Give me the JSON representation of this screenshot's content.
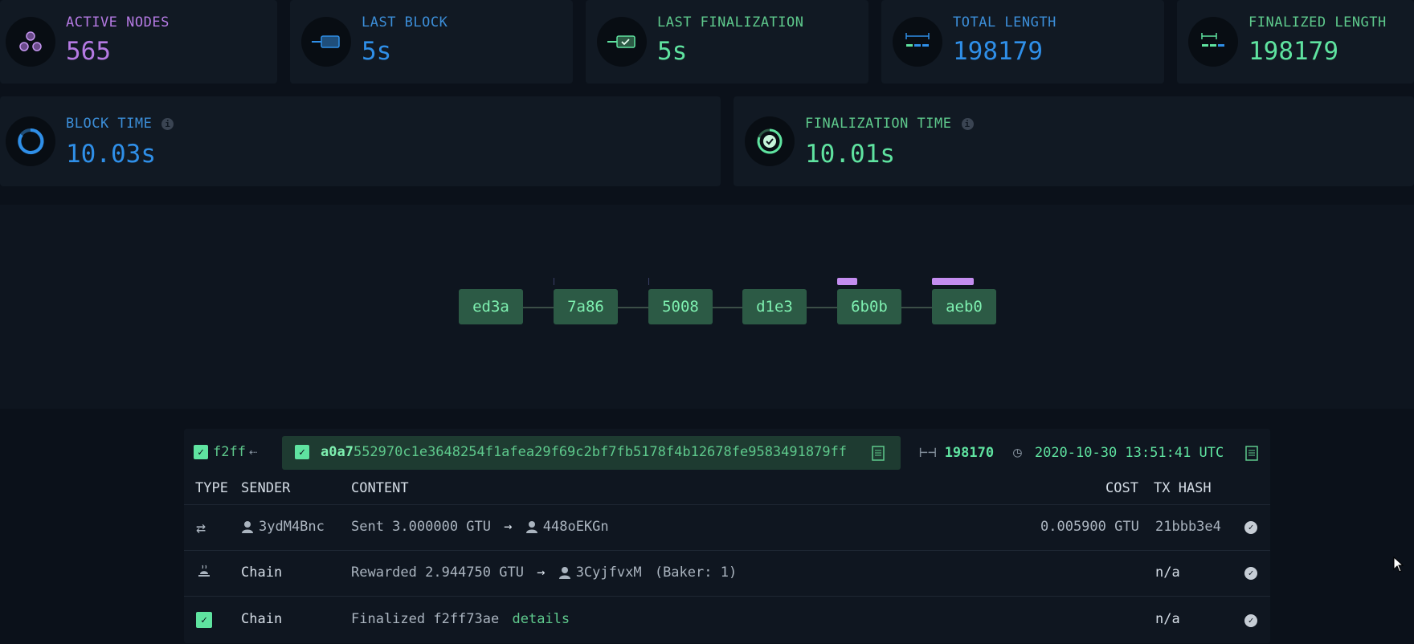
{
  "stats_top": [
    {
      "label": "ACTIVE NODES",
      "value": "565",
      "icon": "nodes-icon"
    },
    {
      "label": "LAST BLOCK",
      "value": "5s",
      "icon": "block-icon"
    },
    {
      "label": "LAST FINALIZATION",
      "value": "5s",
      "icon": "finalized-block-icon"
    },
    {
      "label": "TOTAL LENGTH",
      "value": "198179",
      "icon": "chain-length-icon"
    },
    {
      "label": "FINALIZED LENGTH",
      "value": "198179",
      "icon": "finalized-length-icon"
    }
  ],
  "stats_bottom": [
    {
      "label": "BLOCK TIME",
      "value": "10.03s",
      "icon": "block-time-icon"
    },
    {
      "label": "FINALIZATION TIME",
      "value": "10.01s",
      "icon": "finalization-time-icon"
    }
  ],
  "chain": {
    "blocks": [
      "ed3a",
      "7a86",
      "5008",
      "d1e3",
      "6b0b",
      "aeb0"
    ]
  },
  "block_detail": {
    "parent_short": "f2ff",
    "hash_bold": "a0a7",
    "hash_rest": "552970c1e3648254f1afea29f69c2bf7fb5178f4b12678fe9583491879ff",
    "height": "198170",
    "timestamp": "2020-10-30 13:51:41 UTC"
  },
  "table": {
    "headers": {
      "type": "TYPE",
      "sender": "SENDER",
      "content": "CONTENT",
      "cost": "COST",
      "tx_hash": "TX HASH"
    },
    "rows": [
      {
        "type_icon": "transfer-icon",
        "sender": "3ydM4Bnc",
        "content_prefix": "Sent 3.000000 GTU",
        "arrow": "→",
        "recipient": "448oEKGn",
        "content_suffix": "",
        "cost": "0.005900 GTU",
        "tx_hash": "21bbb3e4"
      },
      {
        "type_icon": "baker-reward-icon",
        "sender": "Chain",
        "content_prefix": "Rewarded 2.944750 GTU",
        "arrow": "→",
        "recipient": "3CyjfvxM",
        "content_suffix": "(Baker: 1)",
        "cost": "",
        "tx_hash": "n/a"
      },
      {
        "type_icon": "finalized-check-icon",
        "sender": "Chain",
        "content_prefix": "Finalized f2ff73ae",
        "link": "details",
        "cost": "",
        "tx_hash": "n/a"
      }
    ]
  },
  "colors": {
    "purple": "#b57ae3",
    "blue": "#2f8fe8",
    "green": "#5fe3a0",
    "block": "#2c5a45"
  }
}
